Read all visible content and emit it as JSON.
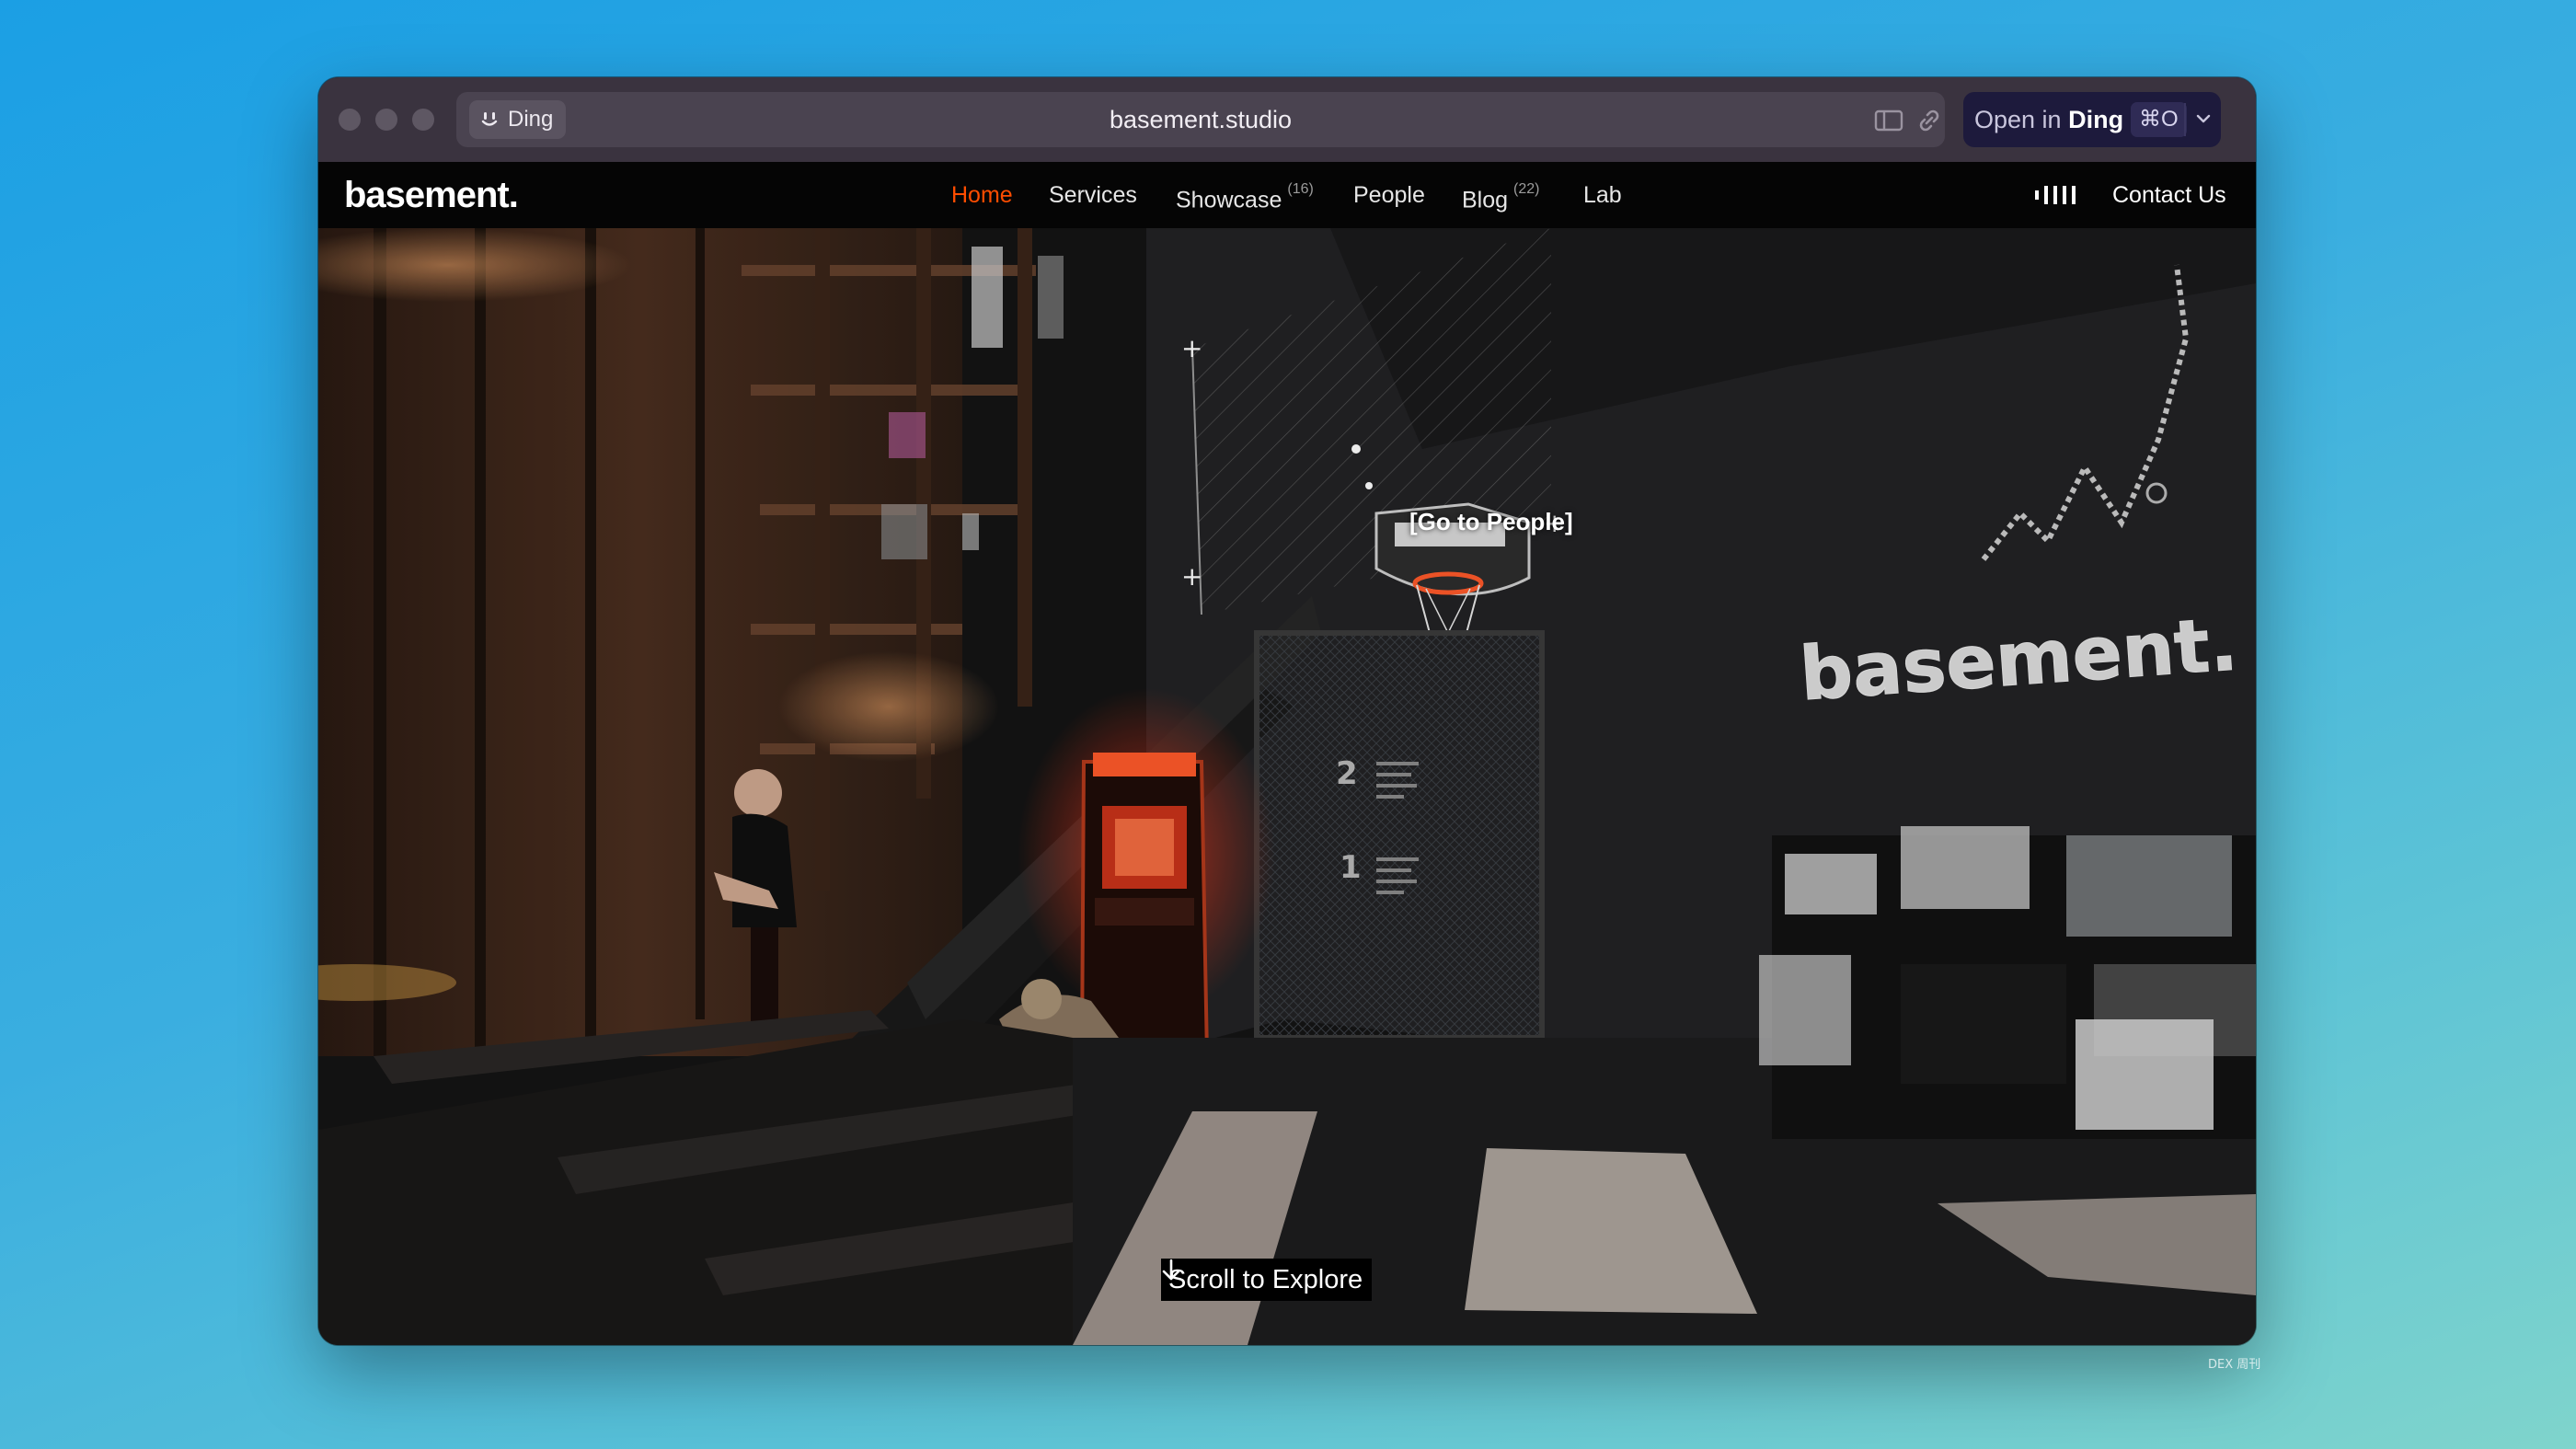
{
  "browser": {
    "chip_label": "Ding",
    "address": "basement.studio",
    "open_button": {
      "prefix": "Open in",
      "app": "Ding",
      "shortcut": "⌘O"
    },
    "icons": [
      "sidebar-icon",
      "link-icon",
      "chevron-down-icon"
    ]
  },
  "site": {
    "logo": "basement.",
    "nav": [
      {
        "label": "Home",
        "active": true
      },
      {
        "label": "Services"
      },
      {
        "label": "Showcase",
        "count": "(16)"
      },
      {
        "label": "People"
      },
      {
        "label": "Blog",
        "count": "(22)"
      },
      {
        "label": "Lab"
      }
    ],
    "contact": "Contact Us",
    "accent_color": "#ff4d00"
  },
  "hero": {
    "hotspot_label": "[Go to People]",
    "scroll_cta": "Scroll to Explore",
    "neon_sign": "basement.",
    "panel_numbers": [
      "2",
      "1"
    ]
  },
  "watermark": "DEX 周刊"
}
